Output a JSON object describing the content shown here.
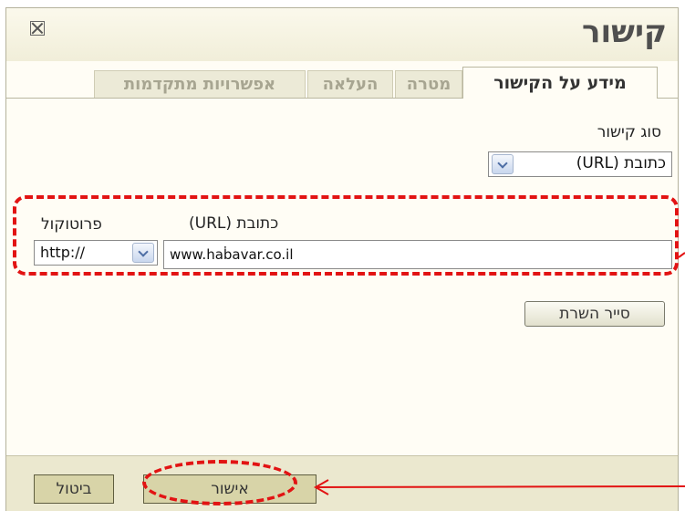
{
  "dialog": {
    "title": "קישור",
    "close_icon": "close-box-icon"
  },
  "tabs": [
    {
      "label": "מידע על הקישור",
      "active": true
    },
    {
      "label": "מטרה",
      "active": false
    },
    {
      "label": "העלאה",
      "active": false
    },
    {
      "label": "אפשרויות מתקדמות",
      "active": false
    }
  ],
  "link_type": {
    "label": "סוג קישור",
    "value": "כתובת (URL)"
  },
  "protocol": {
    "label": "פרוטוקול",
    "value": "http://"
  },
  "url": {
    "label": "כתובת (URL)",
    "value": "www.haḃavar.co.il"
  },
  "buttons": {
    "browse_server": "סייר השרת",
    "ok": "אישור",
    "cancel": "ביטול"
  },
  "annotations": {
    "color": "#e21313"
  },
  "colors": {
    "dialog_bg": "#fffdf5",
    "footer_bg": "#ebe8cf",
    "button_bg": "#d8d4a8"
  }
}
